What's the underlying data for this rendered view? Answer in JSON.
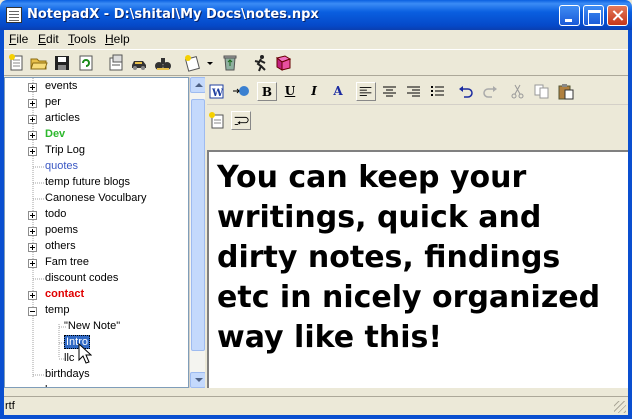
{
  "window": {
    "title": "NotepadX - D:\\shital\\My Docs\\notes.npx"
  },
  "menu": {
    "items": [
      {
        "label": "File",
        "accel": "F"
      },
      {
        "label": "Edit",
        "accel": "E"
      },
      {
        "label": "Tools",
        "accel": "T"
      },
      {
        "label": "Help",
        "accel": "H"
      }
    ]
  },
  "toolbar": {
    "icons": [
      "new-note-icon",
      "open-folder-icon",
      "save-icon",
      "refresh-icon",
      "properties-icon",
      "car-icon",
      "binoculars-icon",
      "new-dropdown-icon",
      "recycle-icon",
      "run-icon",
      "book-icon"
    ]
  },
  "tree": {
    "items": [
      {
        "label": "events",
        "expander": "plus",
        "style": "normal"
      },
      {
        "label": "per",
        "expander": "plus",
        "style": "normal"
      },
      {
        "label": "articles",
        "expander": "plus",
        "style": "normal"
      },
      {
        "label": "Dev",
        "expander": "plus",
        "style": "green-bold"
      },
      {
        "label": "Trip  Log",
        "expander": "plus",
        "style": "normal"
      },
      {
        "label": "quotes",
        "expander": "none",
        "style": "blue"
      },
      {
        "label": "temp future blogs",
        "expander": "none",
        "style": "normal"
      },
      {
        "label": "Canonese Voculbary",
        "expander": "none",
        "style": "normal"
      },
      {
        "label": "todo",
        "expander": "plus",
        "style": "normal"
      },
      {
        "label": "poems",
        "expander": "plus",
        "style": "normal"
      },
      {
        "label": "others",
        "expander": "plus",
        "style": "normal"
      },
      {
        "label": "Fam tree",
        "expander": "plus",
        "style": "normal"
      },
      {
        "label": "discount codes",
        "expander": "none",
        "style": "normal"
      },
      {
        "label": "contact",
        "expander": "plus",
        "style": "red-bold"
      },
      {
        "label": "temp",
        "expander": "minus",
        "style": "normal"
      },
      {
        "label": "\"New Note\"",
        "expander": "child",
        "style": "normal"
      },
      {
        "label": "Intro",
        "expander": "child",
        "style": "selected"
      },
      {
        "label": "llc",
        "expander": "child",
        "style": "normal"
      },
      {
        "label": "birthdays",
        "expander": "none",
        "style": "normal"
      },
      {
        "label": "kpmg",
        "expander": "plus",
        "style": "normal"
      }
    ]
  },
  "format_toolbar": {
    "bold": "B",
    "underline": "U",
    "italic": "I",
    "font_color": "A"
  },
  "editor": {
    "content": "You can keep your writings, quick and dirty notes, findings etc in nicely organized way like this!"
  },
  "status": {
    "text": "rtf"
  },
  "colors": {
    "titlebar": "#0a5fe0",
    "selection": "#316ac5",
    "dev_green": "#2db82d",
    "contact_red": "#e00000",
    "quotes_blue": "#3b58c4"
  }
}
